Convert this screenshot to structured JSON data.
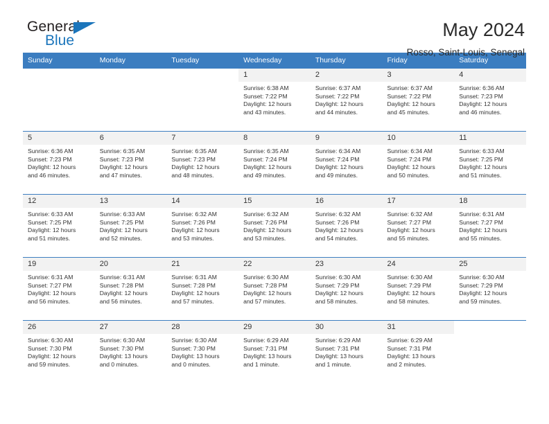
{
  "brand": {
    "name_top": "General",
    "name_bottom": "Blue",
    "accent_color": "#1b75bb",
    "triangle_icon": "brand-triangle-icon"
  },
  "header": {
    "title": "May 2024",
    "location": "Rosso, Saint-Louis, Senegal"
  },
  "theme": {
    "header_row_bg": "#3b7dc0",
    "daynum_bg": "#f2f2f2",
    "text": "#333333",
    "separator": "#3b7dc0"
  },
  "weekdays": [
    "Sunday",
    "Monday",
    "Tuesday",
    "Wednesday",
    "Thursday",
    "Friday",
    "Saturday"
  ],
  "labels": {
    "sunrise_prefix": "Sunrise:",
    "sunset_prefix": "Sunset:",
    "daylight_prefix": "Daylight:"
  },
  "weeks": [
    [
      {
        "day": "",
        "empty": true
      },
      {
        "day": "",
        "empty": true
      },
      {
        "day": "",
        "empty": true
      },
      {
        "day": "1",
        "sunrise": "Sunrise: 6:38 AM",
        "sunset": "Sunset: 7:22 PM",
        "daylight1": "Daylight: 12 hours",
        "daylight2": "and 43 minutes."
      },
      {
        "day": "2",
        "sunrise": "Sunrise: 6:37 AM",
        "sunset": "Sunset: 7:22 PM",
        "daylight1": "Daylight: 12 hours",
        "daylight2": "and 44 minutes."
      },
      {
        "day": "3",
        "sunrise": "Sunrise: 6:37 AM",
        "sunset": "Sunset: 7:22 PM",
        "daylight1": "Daylight: 12 hours",
        "daylight2": "and 45 minutes."
      },
      {
        "day": "4",
        "sunrise": "Sunrise: 6:36 AM",
        "sunset": "Sunset: 7:23 PM",
        "daylight1": "Daylight: 12 hours",
        "daylight2": "and 46 minutes."
      }
    ],
    [
      {
        "day": "5",
        "sunrise": "Sunrise: 6:36 AM",
        "sunset": "Sunset: 7:23 PM",
        "daylight1": "Daylight: 12 hours",
        "daylight2": "and 46 minutes."
      },
      {
        "day": "6",
        "sunrise": "Sunrise: 6:35 AM",
        "sunset": "Sunset: 7:23 PM",
        "daylight1": "Daylight: 12 hours",
        "daylight2": "and 47 minutes."
      },
      {
        "day": "7",
        "sunrise": "Sunrise: 6:35 AM",
        "sunset": "Sunset: 7:23 PM",
        "daylight1": "Daylight: 12 hours",
        "daylight2": "and 48 minutes."
      },
      {
        "day": "8",
        "sunrise": "Sunrise: 6:35 AM",
        "sunset": "Sunset: 7:24 PM",
        "daylight1": "Daylight: 12 hours",
        "daylight2": "and 49 minutes."
      },
      {
        "day": "9",
        "sunrise": "Sunrise: 6:34 AM",
        "sunset": "Sunset: 7:24 PM",
        "daylight1": "Daylight: 12 hours",
        "daylight2": "and 49 minutes."
      },
      {
        "day": "10",
        "sunrise": "Sunrise: 6:34 AM",
        "sunset": "Sunset: 7:24 PM",
        "daylight1": "Daylight: 12 hours",
        "daylight2": "and 50 minutes."
      },
      {
        "day": "11",
        "sunrise": "Sunrise: 6:33 AM",
        "sunset": "Sunset: 7:25 PM",
        "daylight1": "Daylight: 12 hours",
        "daylight2": "and 51 minutes."
      }
    ],
    [
      {
        "day": "12",
        "sunrise": "Sunrise: 6:33 AM",
        "sunset": "Sunset: 7:25 PM",
        "daylight1": "Daylight: 12 hours",
        "daylight2": "and 51 minutes."
      },
      {
        "day": "13",
        "sunrise": "Sunrise: 6:33 AM",
        "sunset": "Sunset: 7:25 PM",
        "daylight1": "Daylight: 12 hours",
        "daylight2": "and 52 minutes."
      },
      {
        "day": "14",
        "sunrise": "Sunrise: 6:32 AM",
        "sunset": "Sunset: 7:26 PM",
        "daylight1": "Daylight: 12 hours",
        "daylight2": "and 53 minutes."
      },
      {
        "day": "15",
        "sunrise": "Sunrise: 6:32 AM",
        "sunset": "Sunset: 7:26 PM",
        "daylight1": "Daylight: 12 hours",
        "daylight2": "and 53 minutes."
      },
      {
        "day": "16",
        "sunrise": "Sunrise: 6:32 AM",
        "sunset": "Sunset: 7:26 PM",
        "daylight1": "Daylight: 12 hours",
        "daylight2": "and 54 minutes."
      },
      {
        "day": "17",
        "sunrise": "Sunrise: 6:32 AM",
        "sunset": "Sunset: 7:27 PM",
        "daylight1": "Daylight: 12 hours",
        "daylight2": "and 55 minutes."
      },
      {
        "day": "18",
        "sunrise": "Sunrise: 6:31 AM",
        "sunset": "Sunset: 7:27 PM",
        "daylight1": "Daylight: 12 hours",
        "daylight2": "and 55 minutes."
      }
    ],
    [
      {
        "day": "19",
        "sunrise": "Sunrise: 6:31 AM",
        "sunset": "Sunset: 7:27 PM",
        "daylight1": "Daylight: 12 hours",
        "daylight2": "and 56 minutes."
      },
      {
        "day": "20",
        "sunrise": "Sunrise: 6:31 AM",
        "sunset": "Sunset: 7:28 PM",
        "daylight1": "Daylight: 12 hours",
        "daylight2": "and 56 minutes."
      },
      {
        "day": "21",
        "sunrise": "Sunrise: 6:31 AM",
        "sunset": "Sunset: 7:28 PM",
        "daylight1": "Daylight: 12 hours",
        "daylight2": "and 57 minutes."
      },
      {
        "day": "22",
        "sunrise": "Sunrise: 6:30 AM",
        "sunset": "Sunset: 7:28 PM",
        "daylight1": "Daylight: 12 hours",
        "daylight2": "and 57 minutes."
      },
      {
        "day": "23",
        "sunrise": "Sunrise: 6:30 AM",
        "sunset": "Sunset: 7:29 PM",
        "daylight1": "Daylight: 12 hours",
        "daylight2": "and 58 minutes."
      },
      {
        "day": "24",
        "sunrise": "Sunrise: 6:30 AM",
        "sunset": "Sunset: 7:29 PM",
        "daylight1": "Daylight: 12 hours",
        "daylight2": "and 58 minutes."
      },
      {
        "day": "25",
        "sunrise": "Sunrise: 6:30 AM",
        "sunset": "Sunset: 7:29 PM",
        "daylight1": "Daylight: 12 hours",
        "daylight2": "and 59 minutes."
      }
    ],
    [
      {
        "day": "26",
        "sunrise": "Sunrise: 6:30 AM",
        "sunset": "Sunset: 7:30 PM",
        "daylight1": "Daylight: 12 hours",
        "daylight2": "and 59 minutes."
      },
      {
        "day": "27",
        "sunrise": "Sunrise: 6:30 AM",
        "sunset": "Sunset: 7:30 PM",
        "daylight1": "Daylight: 13 hours",
        "daylight2": "and 0 minutes."
      },
      {
        "day": "28",
        "sunrise": "Sunrise: 6:30 AM",
        "sunset": "Sunset: 7:30 PM",
        "daylight1": "Daylight: 13 hours",
        "daylight2": "and 0 minutes."
      },
      {
        "day": "29",
        "sunrise": "Sunrise: 6:29 AM",
        "sunset": "Sunset: 7:31 PM",
        "daylight1": "Daylight: 13 hours",
        "daylight2": "and 1 minute."
      },
      {
        "day": "30",
        "sunrise": "Sunrise: 6:29 AM",
        "sunset": "Sunset: 7:31 PM",
        "daylight1": "Daylight: 13 hours",
        "daylight2": "and 1 minute."
      },
      {
        "day": "31",
        "sunrise": "Sunrise: 6:29 AM",
        "sunset": "Sunset: 7:31 PM",
        "daylight1": "Daylight: 13 hours",
        "daylight2": "and 2 minutes."
      },
      {
        "day": "",
        "empty": true
      }
    ]
  ]
}
